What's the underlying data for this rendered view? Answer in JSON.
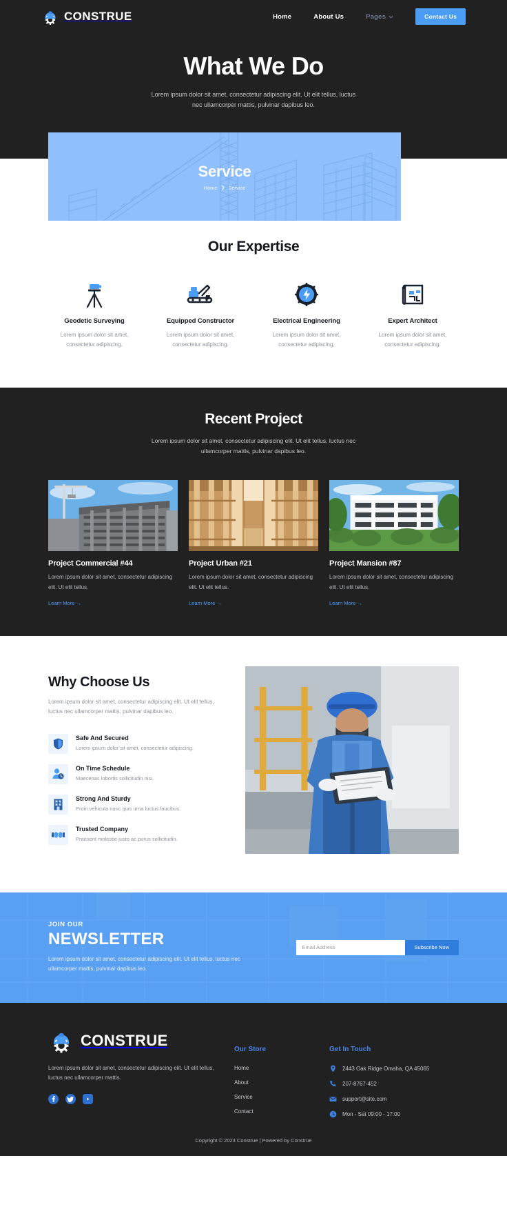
{
  "colors": {
    "accent": "#4b9cf5",
    "accent_dark": "#2f7ede",
    "dark_bg": "#212121",
    "banner_blue": "#8fc0fb",
    "footer_link_head": "#4b84e8"
  },
  "header": {
    "logo_icon": "helmet-gear-icon",
    "brand": "CONSTRUE",
    "nav": [
      {
        "label": "Home",
        "muted": false
      },
      {
        "label": "About Us",
        "muted": false
      },
      {
        "label": "Pages",
        "muted": true,
        "icon": "chevron-down-icon"
      }
    ],
    "cta": "Contact Us"
  },
  "hero": {
    "title": "What We Do",
    "subtitle": "Lorem ipsum dolor sit amet, consectetur adipiscing elit. Ut elit tellus, luctus nec ullamcorper mattis, pulvinar dapibus leo."
  },
  "banner": {
    "title": "Service",
    "crumb_home": "Home",
    "crumb_sep": "❯",
    "crumb_current": "Service"
  },
  "expertise": {
    "title": "Our Expertise",
    "cards": [
      {
        "icon": "surveyor-tripod-icon",
        "title": "Geodetic Surveying",
        "text": "Lorem ipsum dolor sit amet, consectetur adipiscing."
      },
      {
        "icon": "excavator-icon",
        "title": "Equipped Constructor",
        "text": "Lorem ipsum dolor sit amet, consectetur adipiscing."
      },
      {
        "icon": "gear-bolt-icon",
        "title": "Electrical Engineering",
        "text": "Lorem ipsum dolor sit amet, consectetur adipiscing."
      },
      {
        "icon": "blueprint-icon",
        "title": "Expert Architect",
        "text": "Lorem ipsum dolor sit amet, consectetur adipiscing."
      }
    ]
  },
  "projects": {
    "title": "Recent Project",
    "subtitle": "Lorem ipsum dolor sit amet, consectetur adipiscing elit. Ut elit tellus, luctus nec ullamcorper mattis, pulvinar dapibus leo.",
    "items": [
      {
        "image": "highrise-construction-photo",
        "title": "Project Commercial #44",
        "text": "Lorem ipsum dolor sit amet, consectetur adipiscing elit. Ut elit tellus.",
        "link": "Learn More →"
      },
      {
        "image": "timber-framing-interior-photo",
        "title": "Project Urban #21",
        "text": "Lorem ipsum dolor sit amet, consectetur adipiscing elit. Ut elit tellus.",
        "link": "Learn More →"
      },
      {
        "image": "modern-apartment-block-photo",
        "title": "Project Mansion #87",
        "text": "Lorem ipsum dolor sit amet, consectetur adipiscing elit. Ut elit tellus.",
        "link": "Learn More →"
      }
    ]
  },
  "why": {
    "title": "Why Choose Us",
    "subtitle": "Lorem ipsum dolor sit amet, consectetur adipiscing elit. Ut elit tellus, luctus nec ullamcorper mattis, pulvinar dapibus leo.",
    "features": [
      {
        "icon": "shield-icon",
        "title": "Safe And Secured",
        "text": "Lorem ipsum dolor sit amet, consectetur adipiscing."
      },
      {
        "icon": "user-clock-icon",
        "title": "On Time Schedule",
        "text": "Maecenas lobortis sollicitudin nisi."
      },
      {
        "icon": "building-icon",
        "title": "Strong And Sturdy",
        "text": "Proin vehicula nunc quis urna luctus faucibus."
      },
      {
        "icon": "handshake-icon",
        "title": "Trusted Company",
        "text": "Praesent molestie justo ac purus sollicitudin."
      }
    ],
    "image": "worker-with-clipboard-photo"
  },
  "newsletter": {
    "kicker": "JOIN OUR",
    "title": "NEWSLETTER",
    "text": "Lorem ipsum dolor sit amet, consectetur adipiscing elit. Ut elit tellus, luctus nec ullamcorper mattis, pulvinar dapibus leo.",
    "input_placeholder": "Email Address",
    "input_value": "",
    "button": "Subscribe Now"
  },
  "footer": {
    "logo_icon": "helmet-gear-icon",
    "brand": "CONSTRUE",
    "about": "Lorem ipsum dolor sit amet, consectetur adipiscing elit. Ut elit tellus, luctus nec ullamcorper mattis.",
    "socials": [
      {
        "icon": "facebook-icon"
      },
      {
        "icon": "twitter-icon"
      },
      {
        "icon": "youtube-icon"
      }
    ],
    "store": {
      "heading": "Our Store",
      "links": [
        "Home",
        "About",
        "Service",
        "Contact"
      ]
    },
    "touch": {
      "heading": "Get In Touch",
      "rows": [
        {
          "icon": "location-pin-icon",
          "text": "2443 Oak Ridge Omaha, QA 45065"
        },
        {
          "icon": "phone-icon",
          "text": "207-8767-452"
        },
        {
          "icon": "envelope-icon",
          "text": "support@site.com"
        },
        {
          "icon": "clock-icon",
          "text": "Mon - Sat 09:00 - 17:00"
        }
      ]
    },
    "copyright": "Copyright © 2023 Construe | Powered by Construe"
  }
}
